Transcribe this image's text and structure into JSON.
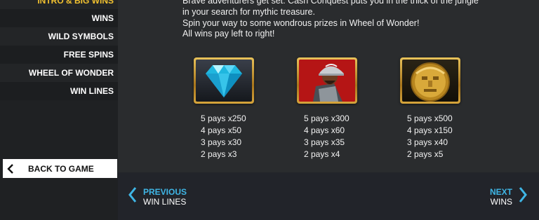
{
  "sidebar": {
    "items": [
      {
        "label": "INTRO & BIG WINS",
        "active": true
      },
      {
        "label": "WINS",
        "active": false
      },
      {
        "label": "WILD SYMBOLS",
        "active": false
      },
      {
        "label": "FREE SPINS",
        "active": false
      },
      {
        "label": "WHEEL OF WONDER",
        "active": false
      },
      {
        "label": "WIN LINES",
        "active": false
      }
    ],
    "back_label": "BACK TO GAME"
  },
  "intro": {
    "lines": [
      "Brave adventurers get set. Cash Conquest puts you in the thick of the jungle",
      "in your search for mythic treasure.",
      "Spin your way to some wondrous prizes in Wheel of Wonder!",
      "All wins pay left to right!"
    ]
  },
  "symbols": [
    {
      "icon": "diamond-icon",
      "pays": [
        "5 pays x250",
        "4 pays x50",
        "3 pays x30",
        "2 pays x3"
      ]
    },
    {
      "icon": "conquistador-icon",
      "pays": [
        "5 pays x300",
        "4 pays x60",
        "3 pays x35",
        "2 pays x4"
      ]
    },
    {
      "icon": "gold-mask-icon",
      "pays": [
        "5 pays x500",
        "4 pays x150",
        "3 pays x40",
        "2 pays x5"
      ]
    }
  ],
  "footer": {
    "prev": {
      "small": "PREVIOUS",
      "big": "WIN LINES"
    },
    "next": {
      "small": "NEXT",
      "big": "WINS"
    }
  },
  "colors": {
    "accent": "#f2c230",
    "nav_blue": "#3fb6e6",
    "background": "#2a2c2e"
  }
}
